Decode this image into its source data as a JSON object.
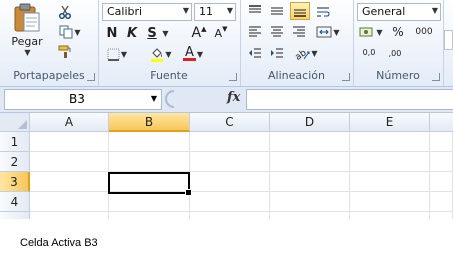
{
  "ribbon": {
    "clipboard": {
      "group_label": "Portapapeles",
      "paste_label": "Pegar"
    },
    "font": {
      "group_label": "Fuente",
      "font_name": "Calibri",
      "font_size": "11",
      "bold_label": "N",
      "italic_label": "K",
      "underline_label": "S",
      "grow_label": "A",
      "shrink_label": "A",
      "font_color_label": "A"
    },
    "alignment": {
      "group_label": "Alineación"
    },
    "number": {
      "group_label": "Número",
      "format": "General",
      "percent": "%",
      "thousands": "000",
      "more_dec": "0,0",
      "less_dec": ",00"
    }
  },
  "formula_bar": {
    "name_box": "B3",
    "fx": "fx",
    "formula": ""
  },
  "grid": {
    "columns": [
      "A",
      "B",
      "C",
      "D",
      "E"
    ],
    "rows": [
      "1",
      "2",
      "3",
      "4"
    ],
    "active_col": "B",
    "active_row": "3"
  },
  "caption": "Celda Activa B3",
  "colors": {
    "selection_header": "#f7c75a",
    "font_color_bar": "#e02020",
    "fill_color_bar": "#ffff00"
  }
}
